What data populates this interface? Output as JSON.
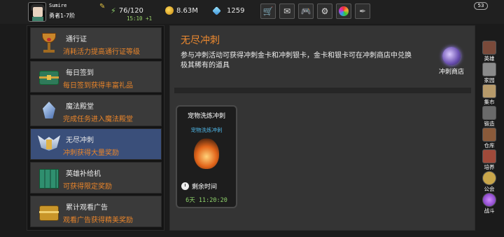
{
  "topbar": {
    "username": "Sumire",
    "rank": "勇者1-7阶",
    "stamina": "76/120",
    "gold": "8.63M",
    "gems": "1259",
    "timer": "15:10 +1",
    "message_count": "53",
    "buttons": [
      "shop-cart-icon",
      "mail-icon",
      "gamepad-icon",
      "gear-icon",
      "color-wheel-icon",
      "feather-icon"
    ]
  },
  "left_menu": {
    "items": [
      {
        "title": "通行证",
        "desc": "消耗活力提高通行证等级",
        "icon": "goblet-icon"
      },
      {
        "title": "每日签到",
        "desc": "每日签到获得丰富礼品",
        "icon": "treasure-chest-icon"
      },
      {
        "title": "魔法殿堂",
        "desc": "完成任务进入魔法殿堂",
        "icon": "crystal-icon"
      },
      {
        "title": "无尽冲刺",
        "desc": "冲刺获得大量奖励",
        "icon": "winged-shield-icon"
      },
      {
        "title": "英雄补给机",
        "desc": "可获得限定奖励",
        "icon": "green-machine-icon"
      },
      {
        "title": "累计观看广告",
        "desc": "观看广告获得精美奖励",
        "icon": "gold-chest-icon"
      }
    ]
  },
  "main": {
    "heading": "无尽冲刺",
    "description": "参与冲刺活动可获得冲刺金卡和冲刺银卡，金卡和银卡可在冲刺商店中兑换极其稀有的道具",
    "shop_label": "冲刺商店",
    "card": {
      "title": "宠物洗炼冲刺",
      "subtitle": "宠物洗炼冲刺",
      "remain_label": "剩余时间",
      "time": "6天 11:20:20"
    }
  },
  "right_bar": {
    "items": [
      {
        "label": "英雄",
        "color": "#7a4a3a"
      },
      {
        "label": "家园",
        "color": "#8a8a8a"
      },
      {
        "label": "集市",
        "color": "#b79a6a"
      },
      {
        "label": "锻造",
        "color": "#6a6a6a"
      },
      {
        "label": "仓库",
        "color": "#8a5a3a"
      },
      {
        "label": "培养",
        "color": "#a04a3a"
      },
      {
        "label": "公会",
        "color": "#c9a64a"
      },
      {
        "label": "战斗",
        "color": "#7a3ab0"
      }
    ]
  }
}
